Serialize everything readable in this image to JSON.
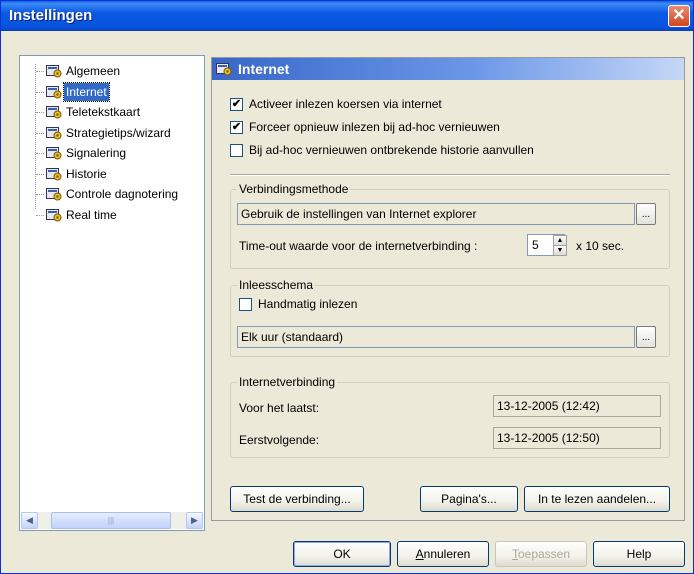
{
  "window": {
    "title": "Instellingen"
  },
  "tree": {
    "items": [
      {
        "label": "Algemeen",
        "selected": false,
        "icon": "settings-folder-icon"
      },
      {
        "label": "Internet",
        "selected": true,
        "icon": "settings-folder-icon"
      },
      {
        "label": "Teletekstkaart",
        "selected": false,
        "icon": "settings-folder-icon"
      },
      {
        "label": "Strategietips/wizard",
        "selected": false,
        "icon": "settings-folder-icon"
      },
      {
        "label": "Signalering",
        "selected": false,
        "icon": "settings-folder-icon"
      },
      {
        "label": "Historie",
        "selected": false,
        "icon": "settings-folder-icon"
      },
      {
        "label": "Controle dagnotering",
        "selected": false,
        "icon": "settings-folder-icon"
      },
      {
        "label": "Real time",
        "selected": false,
        "icon": "settings-folder-icon"
      }
    ]
  },
  "panel": {
    "title": "Internet",
    "options": [
      {
        "label": "Activeer inlezen koersen via internet",
        "checked": true
      },
      {
        "label": "Forceer opnieuw inlezen bij ad-hoc vernieuwen",
        "checked": true
      },
      {
        "label": "Bij ad-hoc vernieuwen ontbrekende historie aanvullen",
        "checked": false
      }
    ],
    "connection": {
      "legend": "Verbindingsmethode",
      "method": "Gebruik de instellingen van Internet explorer",
      "browse_label": "...",
      "timeout_label": "Time-out waarde voor de internetverbinding :",
      "timeout_value": "5",
      "timeout_unit": "x 10 sec."
    },
    "schedule": {
      "legend": "Inleesschema",
      "manual_label": "Handmatig inlezen",
      "manual_checked": false,
      "schedule_value": "Elk uur (standaard)",
      "browse_label": "..."
    },
    "status": {
      "legend": "Internetverbinding",
      "last_label": "Voor het laatst:",
      "last_value": "13-12-2005 (12:42)",
      "next_label": "Eerstvolgende:",
      "next_value": "13-12-2005 (12:50)"
    },
    "buttons": {
      "test": "Test de verbinding...",
      "pages": "Pagina's...",
      "stocks": "In te lezen aandelen..."
    }
  },
  "footer": {
    "ok": "OK",
    "cancel": "Annuleren",
    "apply": "Toepassen",
    "help": "Help"
  },
  "colors": {
    "accent": "#316ac5",
    "title_bar": "#0753dc"
  }
}
